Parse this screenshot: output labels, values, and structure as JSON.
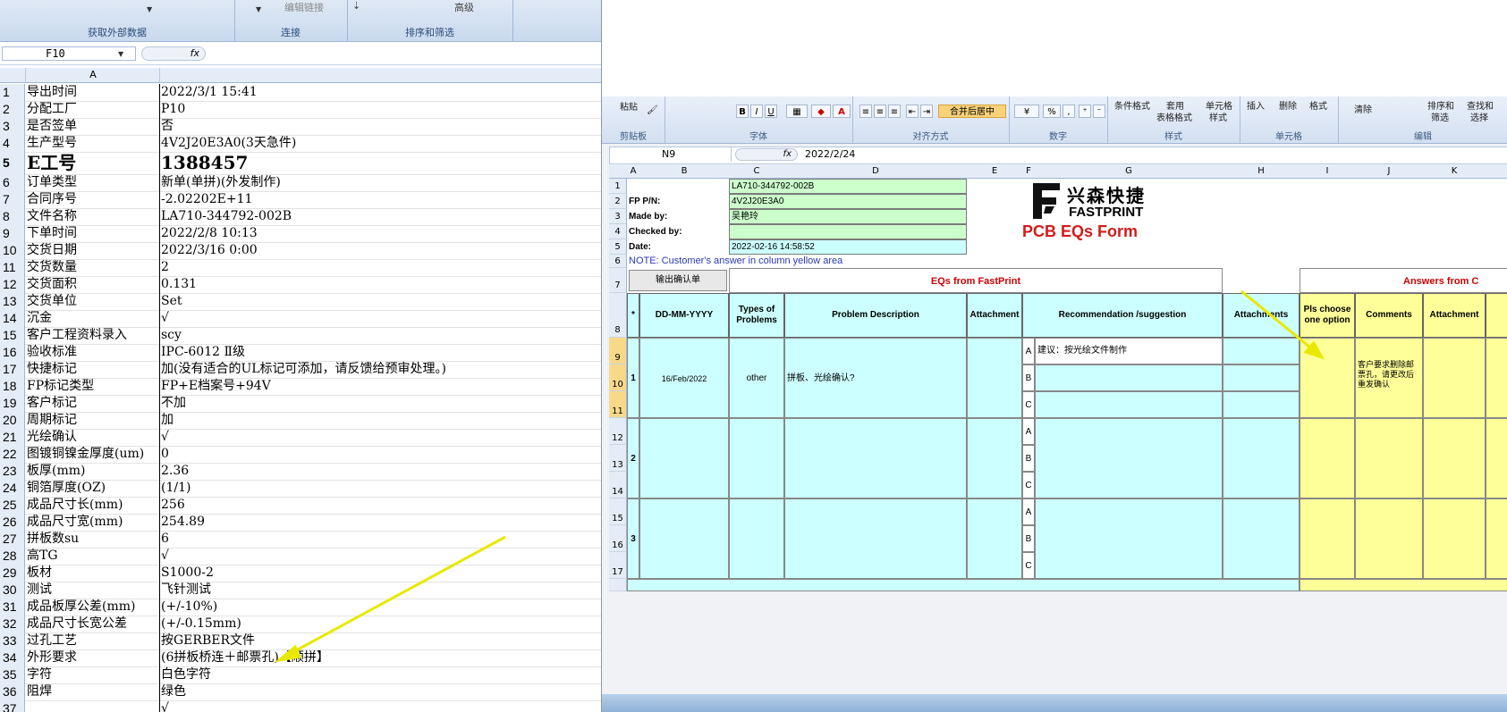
{
  "left": {
    "ribbon": {
      "groups": [
        "获取外部数据",
        "连接",
        "排序和筛选"
      ],
      "edit_links": "编辑链接",
      "advanced": "高级"
    },
    "name_box": "F10",
    "fx_symbol": "fx",
    "column_a": "A",
    "rows": [
      {
        "n": "1",
        "a": "导出时间",
        "b": "2022/3/1 15:41"
      },
      {
        "n": "2",
        "a": "分配工厂",
        "b": "P10"
      },
      {
        "n": "3",
        "a": "是否签单",
        "b": "否"
      },
      {
        "n": "4",
        "a": "生产型号",
        "b": "4V2J20E3A0(3天急件)"
      },
      {
        "n": "5",
        "a": "E工号",
        "b": "1388457"
      },
      {
        "n": "6",
        "a": "订单类型",
        "b": "新单(单拼)(外发制作)"
      },
      {
        "n": "7",
        "a": "合同序号",
        "b": "-2.02202E+11"
      },
      {
        "n": "8",
        "a": "文件名称",
        "b": "LA710-344792-002B"
      },
      {
        "n": "9",
        "a": "下单时间",
        "b": "2022/2/8 10:13"
      },
      {
        "n": "10",
        "a": "交货日期",
        "b": "2022/3/16 0:00"
      },
      {
        "n": "11",
        "a": "交货数量",
        "b": "2"
      },
      {
        "n": "12",
        "a": "交货面积",
        "b": "0.131"
      },
      {
        "n": "13",
        "a": "交货单位",
        "b": "Set"
      },
      {
        "n": "14",
        "a": "沉金",
        "b": "√"
      },
      {
        "n": "15",
        "a": "客户工程资料录入",
        "b": "scy"
      },
      {
        "n": "16",
        "a": "验收标准",
        "b": "IPC-6012 Ⅱ级"
      },
      {
        "n": "17",
        "a": "快捷标记",
        "b": "加(没有适合的UL标记可添加，请反馈给预审处理。)"
      },
      {
        "n": "18",
        "a": "FP标记类型",
        "b": "FP+E档案号+94V"
      },
      {
        "n": "19",
        "a": "客户标记",
        "b": "不加"
      },
      {
        "n": "20",
        "a": "周期标记",
        "b": "加"
      },
      {
        "n": "21",
        "a": "光绘确认",
        "b": "√"
      },
      {
        "n": "22",
        "a": "图镀铜镍金厚度(um)",
        "b": "0"
      },
      {
        "n": "23",
        "a": "板厚(mm)",
        "b": "2.36"
      },
      {
        "n": "24",
        "a": "铜箔厚度(OZ)",
        "b": "(1/1)"
      },
      {
        "n": "25",
        "a": "成品尺寸长(mm)",
        "b": "256"
      },
      {
        "n": "26",
        "a": "成品尺寸宽(mm)",
        "b": "254.89"
      },
      {
        "n": "27",
        "a": "拼板数su",
        "b": "6"
      },
      {
        "n": "28",
        "a": "高TG",
        "b": "√"
      },
      {
        "n": "29",
        "a": "板材",
        "b": "S1000-2"
      },
      {
        "n": "30",
        "a": "测试",
        "b": "飞针测试"
      },
      {
        "n": "31",
        "a": "成品板厚公差(mm)",
        "b": "(+/-10%)"
      },
      {
        "n": "32",
        "a": "成品尺寸长宽公差",
        "b": "(+/-0.15mm)"
      },
      {
        "n": "33",
        "a": "过孔工艺",
        "b": "按GERBER文件"
      },
      {
        "n": "34",
        "a": "外形要求",
        "b": "(6拼板桥连＋邮票孔)【顺拼】"
      },
      {
        "n": "35",
        "a": "字符",
        "b": "白色字符"
      },
      {
        "n": "36",
        "a": "阻焊",
        "b": "绿色"
      },
      {
        "n": "37",
        "a": "",
        "b": "√"
      }
    ]
  },
  "right": {
    "ribbon": {
      "paste": "粘贴",
      "clipboard": "剪贴板",
      "font": "字体",
      "alignment": "对齐方式",
      "number": "数字",
      "styles": "样式",
      "cells": "单元格",
      "editing": "编辑",
      "merge_center": "合并后居中",
      "percent": "%",
      "conditional_format": "条件格式",
      "table_format": "表格格式",
      "apply": "套用",
      "cell_style_1": "单元格",
      "cell_style_2": "样式",
      "insert": "插入",
      "delete": "删除",
      "format": "格式",
      "clear": "清除",
      "sort_filter_1": "排序和",
      "sort_filter_2": "筛选",
      "find_select_1": "查找和",
      "find_select_2": "选择",
      "bold": "B",
      "italic": "I",
      "underline": "U"
    },
    "name_box": "N9",
    "fx_symbol": "fx",
    "formula_value": "2022/2/24",
    "columns": [
      "A",
      "B",
      "C",
      "D",
      "E",
      "F",
      "G",
      "H",
      "I",
      "J",
      "K"
    ],
    "info": {
      "file_no": "LA710-344792-002B",
      "fp_pn_label": "FP P/N:",
      "fp_pn": "4V2J20E3A0",
      "made_by_label": "Made by:",
      "made_by": "吴艳玲",
      "checked_by_label": "Checked by:",
      "date_label": "Date:",
      "date": "2022-02-16 14:58:52",
      "note": "NOTE: Customer's  answer in column yellow area"
    },
    "logo": {
      "cn": "兴森快捷",
      "en": "FASTPRINT",
      "form_title": "PCB EQs Form"
    },
    "button_export": "输出确认单",
    "eq_header": "EQs from FastPrint",
    "answers_header": "Answers from C",
    "headers": {
      "star": "*",
      "date": "DD-MM-YYYY",
      "types": "Types of Problems",
      "desc": "Problem Description",
      "attach1": "Attachment",
      "rec": "Recommendation /suggestion",
      "attach2": "Attachments",
      "choose": "Pls choose one option",
      "comments": "Comments",
      "attach3": "Attachment"
    },
    "eq1": {
      "no": "1",
      "date": "16/Feb/2022",
      "type": "other",
      "desc": "拼板、光绘确认?",
      "opt_a": "A",
      "opt_b": "B",
      "opt_c": "C",
      "rec_a": "建议：按光绘文件制作",
      "comment": "客户要求删除邮票孔，请更改后重发确认"
    },
    "eq2": {
      "no": "2"
    },
    "eq3": {
      "no": "3"
    },
    "row_numbers": [
      "1",
      "2",
      "3",
      "4",
      "5",
      "6",
      "7",
      "8",
      "9",
      "10",
      "11",
      "12",
      "13",
      "14",
      "15",
      "16",
      "17"
    ]
  }
}
